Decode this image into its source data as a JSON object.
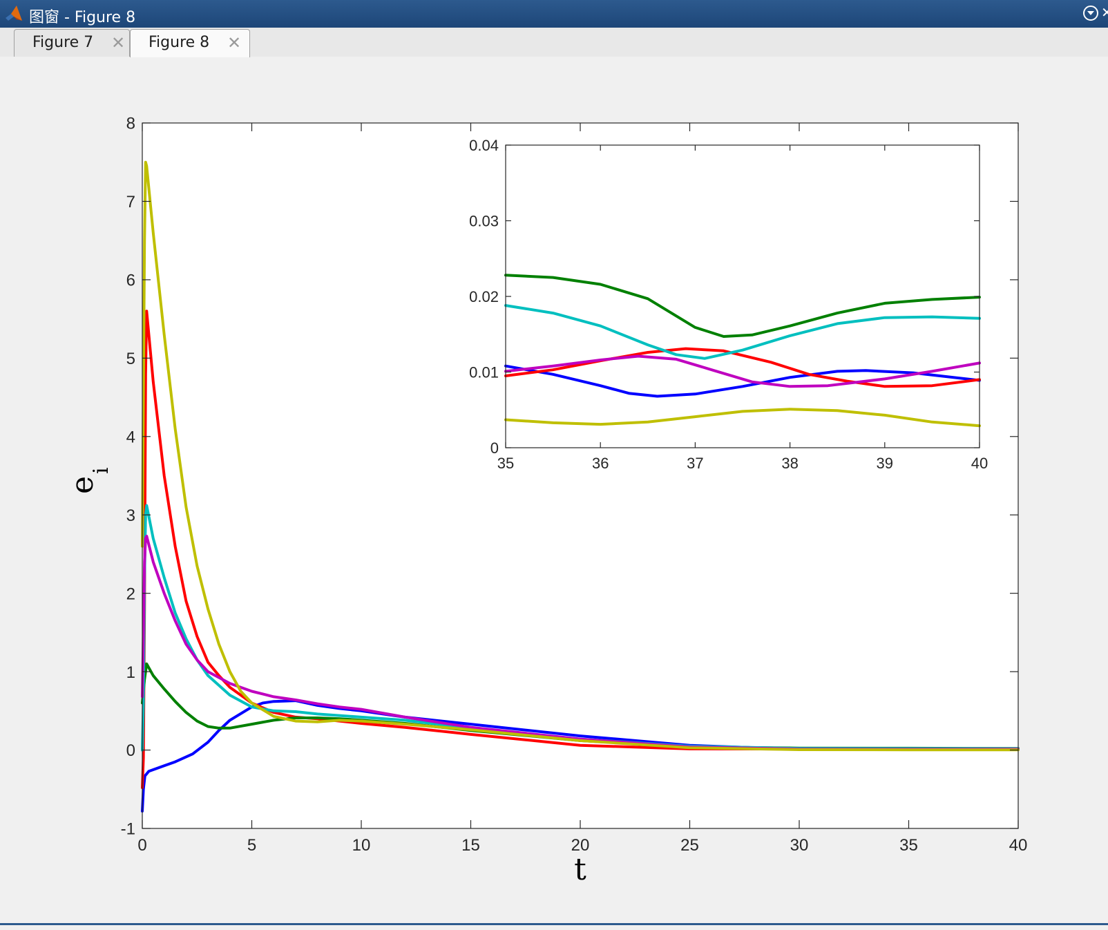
{
  "window": {
    "title": "图窗 - Figure 8"
  },
  "tabs": [
    {
      "label": "Figure 7",
      "active": false
    },
    {
      "label": "Figure 8",
      "active": true
    }
  ],
  "icons": {
    "app": "matlab-logo-icon",
    "window_menu": "chevron-down-circle-icon",
    "tab_close": "close-icon"
  },
  "chart_data": [
    {
      "type": "line",
      "xlabel": "t",
      "ylabel": "e",
      "ylabel_subscript": "i",
      "xlim": [
        0,
        40
      ],
      "ylim": [
        -1,
        8
      ],
      "xticks": [
        0,
        5,
        10,
        15,
        20,
        25,
        30,
        35,
        40
      ],
      "yticks": [
        -1,
        0,
        1,
        2,
        3,
        4,
        5,
        6,
        7,
        8
      ],
      "grid": false,
      "series": [
        {
          "color": "#0000ff",
          "points": [
            [
              0,
              -0.78
            ],
            [
              0.05,
              -0.5
            ],
            [
              0.12,
              -0.33
            ],
            [
              0.3,
              -0.27
            ],
            [
              1,
              -0.2
            ],
            [
              1.5,
              -0.15
            ],
            [
              2.3,
              -0.05
            ],
            [
              3,
              0.1
            ],
            [
              3.5,
              0.25
            ],
            [
              4,
              0.38
            ],
            [
              5,
              0.55
            ],
            [
              5.5,
              0.6
            ],
            [
              6,
              0.62
            ],
            [
              7,
              0.63
            ],
            [
              8,
              0.57
            ],
            [
              9,
              0.53
            ],
            [
              10,
              0.5
            ],
            [
              11,
              0.46
            ],
            [
              12,
              0.42
            ],
            [
              15,
              0.33
            ],
            [
              20,
              0.18
            ],
            [
              25,
              0.06
            ],
            [
              28,
              0.03
            ],
            [
              30,
              0.02
            ],
            [
              35,
              0.012
            ],
            [
              40,
              0.008
            ]
          ]
        },
        {
          "color": "#ff0000",
          "points": [
            [
              0,
              -0.48
            ],
            [
              0.05,
              -0.1
            ],
            [
              0.1,
              1.8
            ],
            [
              0.15,
              4.8
            ],
            [
              0.2,
              5.6
            ],
            [
              0.5,
              4.7
            ],
            [
              1,
              3.5
            ],
            [
              1.5,
              2.6
            ],
            [
              2,
              1.9
            ],
            [
              2.5,
              1.45
            ],
            [
              3,
              1.12
            ],
            [
              3.5,
              0.95
            ],
            [
              4,
              0.8
            ],
            [
              5,
              0.6
            ],
            [
              6,
              0.48
            ],
            [
              7,
              0.42
            ],
            [
              8,
              0.4
            ],
            [
              10,
              0.34
            ],
            [
              12,
              0.29
            ],
            [
              15,
              0.2
            ],
            [
              20,
              0.06
            ],
            [
              25,
              0.015
            ],
            [
              30,
              0.012
            ],
            [
              35,
              0.009
            ],
            [
              40,
              0.009
            ]
          ]
        },
        {
          "color": "#008000",
          "points": [
            [
              0,
              0.6
            ],
            [
              0.1,
              0.9
            ],
            [
              0.2,
              1.1
            ],
            [
              0.5,
              0.95
            ],
            [
              1,
              0.78
            ],
            [
              1.5,
              0.62
            ],
            [
              2,
              0.48
            ],
            [
              2.5,
              0.37
            ],
            [
              3,
              0.3
            ],
            [
              3.5,
              0.28
            ],
            [
              4,
              0.28
            ],
            [
              5,
              0.33
            ],
            [
              6,
              0.38
            ],
            [
              7,
              0.41
            ],
            [
              8,
              0.41
            ],
            [
              9,
              0.4
            ],
            [
              10,
              0.38
            ],
            [
              12,
              0.34
            ],
            [
              15,
              0.25
            ],
            [
              20,
              0.12
            ],
            [
              25,
              0.04
            ],
            [
              30,
              0.025
            ],
            [
              35,
              0.023
            ],
            [
              40,
              0.02
            ]
          ]
        },
        {
          "color": "#00bfbf",
          "points": [
            [
              0,
              0
            ],
            [
              0.05,
              0.6
            ],
            [
              0.1,
              2.2
            ],
            [
              0.15,
              3.0
            ],
            [
              0.2,
              3.12
            ],
            [
              0.5,
              2.7
            ],
            [
              1,
              2.2
            ],
            [
              1.5,
              1.75
            ],
            [
              2,
              1.42
            ],
            [
              2.5,
              1.15
            ],
            [
              3,
              0.95
            ],
            [
              4,
              0.7
            ],
            [
              5,
              0.55
            ],
            [
              6,
              0.5
            ],
            [
              7,
              0.49
            ],
            [
              8,
              0.46
            ],
            [
              9,
              0.44
            ],
            [
              10,
              0.42
            ],
            [
              12,
              0.38
            ],
            [
              15,
              0.28
            ],
            [
              20,
              0.14
            ],
            [
              25,
              0.05
            ],
            [
              30,
              0.02
            ],
            [
              35,
              0.019
            ],
            [
              40,
              0.017
            ]
          ]
        },
        {
          "color": "#bf00bf",
          "points": [
            [
              0,
              0.68
            ],
            [
              0.05,
              1.5
            ],
            [
              0.1,
              2.4
            ],
            [
              0.15,
              2.7
            ],
            [
              0.2,
              2.73
            ],
            [
              0.5,
              2.4
            ],
            [
              1,
              2.0
            ],
            [
              1.5,
              1.65
            ],
            [
              2,
              1.35
            ],
            [
              2.5,
              1.15
            ],
            [
              3,
              1.0
            ],
            [
              4,
              0.85
            ],
            [
              5,
              0.75
            ],
            [
              6,
              0.68
            ],
            [
              7,
              0.64
            ],
            [
              8,
              0.59
            ],
            [
              9,
              0.55
            ],
            [
              10,
              0.52
            ],
            [
              12,
              0.42
            ],
            [
              15,
              0.29
            ],
            [
              20,
              0.14
            ],
            [
              25,
              0.04
            ],
            [
              30,
              0.012
            ],
            [
              35,
              0.01
            ],
            [
              40,
              0.011
            ]
          ]
        },
        {
          "color": "#bfbf00",
          "points": [
            [
              0,
              2.6
            ],
            [
              0.05,
              4.5
            ],
            [
              0.1,
              6.5
            ],
            [
              0.15,
              7.5
            ],
            [
              0.2,
              7.45
            ],
            [
              0.5,
              6.6
            ],
            [
              1,
              5.3
            ],
            [
              1.5,
              4.1
            ],
            [
              2,
              3.1
            ],
            [
              2.5,
              2.35
            ],
            [
              3,
              1.8
            ],
            [
              3.5,
              1.35
            ],
            [
              4,
              1.0
            ],
            [
              4.5,
              0.75
            ],
            [
              5,
              0.6
            ],
            [
              6,
              0.43
            ],
            [
              7,
              0.37
            ],
            [
              8,
              0.36
            ],
            [
              9,
              0.38
            ],
            [
              10,
              0.37
            ],
            [
              12,
              0.33
            ],
            [
              15,
              0.26
            ],
            [
              20,
              0.12
            ],
            [
              25,
              0.03
            ],
            [
              30,
              0.005
            ],
            [
              35,
              0.003
            ],
            [
              40,
              0.003
            ]
          ]
        }
      ]
    },
    {
      "type": "line",
      "xlim": [
        35,
        40
      ],
      "ylim": [
        0,
        0.04
      ],
      "xticks": [
        35,
        36,
        37,
        38,
        39,
        40
      ],
      "yticks": [
        0,
        0.01,
        0.02,
        0.03,
        0.04
      ],
      "grid": false,
      "series": [
        {
          "color": "#0000ff",
          "points": [
            [
              35,
              0.0108
            ],
            [
              35.5,
              0.0097
            ],
            [
              36,
              0.0082
            ],
            [
              36.3,
              0.0072
            ],
            [
              36.6,
              0.0068
            ],
            [
              37,
              0.0071
            ],
            [
              37.5,
              0.0081
            ],
            [
              38,
              0.0093
            ],
            [
              38.5,
              0.0101
            ],
            [
              38.8,
              0.0102
            ],
            [
              39.3,
              0.0099
            ],
            [
              40,
              0.0089
            ]
          ]
        },
        {
          "color": "#ff0000",
          "points": [
            [
              35,
              0.0095
            ],
            [
              35.5,
              0.0103
            ],
            [
              36,
              0.0115
            ],
            [
              36.5,
              0.0126
            ],
            [
              36.9,
              0.0131
            ],
            [
              37.3,
              0.0128
            ],
            [
              37.8,
              0.0113
            ],
            [
              38.2,
              0.0097
            ],
            [
              38.6,
              0.0088
            ],
            [
              39,
              0.0081
            ],
            [
              39.5,
              0.0082
            ],
            [
              40,
              0.009
            ]
          ]
        },
        {
          "color": "#008000",
          "points": [
            [
              35,
              0.0228
            ],
            [
              35.5,
              0.0225
            ],
            [
              36,
              0.0216
            ],
            [
              36.5,
              0.0197
            ],
            [
              37,
              0.0159
            ],
            [
              37.3,
              0.0147
            ],
            [
              37.6,
              0.0149
            ],
            [
              38,
              0.0161
            ],
            [
              38.5,
              0.0178
            ],
            [
              39,
              0.0191
            ],
            [
              39.5,
              0.0196
            ],
            [
              40,
              0.0199
            ]
          ]
        },
        {
          "color": "#00bfbf",
          "points": [
            [
              35,
              0.0188
            ],
            [
              35.5,
              0.0178
            ],
            [
              36,
              0.0161
            ],
            [
              36.5,
              0.0136
            ],
            [
              36.8,
              0.0123
            ],
            [
              37.1,
              0.0118
            ],
            [
              37.5,
              0.0129
            ],
            [
              38,
              0.0148
            ],
            [
              38.5,
              0.0164
            ],
            [
              39,
              0.0172
            ],
            [
              39.5,
              0.0173
            ],
            [
              40,
              0.0171
            ]
          ]
        },
        {
          "color": "#bf00bf",
          "points": [
            [
              35,
              0.0101
            ],
            [
              35.5,
              0.0108
            ],
            [
              36,
              0.0116
            ],
            [
              36.4,
              0.0121
            ],
            [
              36.8,
              0.0117
            ],
            [
              37.2,
              0.0102
            ],
            [
              37.6,
              0.0087
            ],
            [
              38,
              0.0081
            ],
            [
              38.4,
              0.0082
            ],
            [
              39,
              0.0091
            ],
            [
              39.5,
              0.0101
            ],
            [
              40,
              0.0112
            ]
          ]
        },
        {
          "color": "#bfbf00",
          "points": [
            [
              35,
              0.0037
            ],
            [
              35.5,
              0.0033
            ],
            [
              36,
              0.0031
            ],
            [
              36.5,
              0.0034
            ],
            [
              37,
              0.0041
            ],
            [
              37.5,
              0.0048
            ],
            [
              38,
              0.0051
            ],
            [
              38.5,
              0.0049
            ],
            [
              39,
              0.0043
            ],
            [
              39.5,
              0.0034
            ],
            [
              40,
              0.0029
            ]
          ]
        }
      ]
    }
  ]
}
